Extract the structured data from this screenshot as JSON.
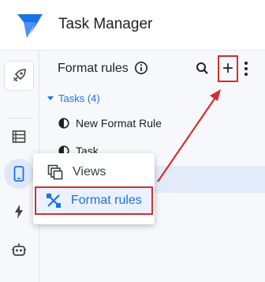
{
  "app": {
    "title": "Task Manager",
    "logo_icon": "appsheet-logo-icon"
  },
  "colors": {
    "accent": "#1a73e8",
    "highlight": "#d32f2f",
    "rail_bg": "#f7f8fb"
  },
  "rail": {
    "items": [
      {
        "icon": "rocket-icon"
      },
      {
        "icon": "table-icon"
      },
      {
        "icon": "mobile-icon"
      },
      {
        "icon": "bolt-icon"
      },
      {
        "icon": "bot-icon"
      }
    ]
  },
  "panel": {
    "title": "Format rules",
    "info_icon": "info-icon",
    "search_icon": "search-icon",
    "add_label": "+",
    "more_icon": "more-vert-icon",
    "group": {
      "label": "Tasks (4)"
    },
    "rules": [
      {
        "label": "New Format Rule"
      },
      {
        "label": "Task"
      },
      {
        "label": ""
      }
    ]
  },
  "menu": {
    "items": [
      {
        "label": "Views",
        "icon": "views-icon"
      },
      {
        "label": "Format rules",
        "icon": "format-rules-icon"
      }
    ]
  }
}
